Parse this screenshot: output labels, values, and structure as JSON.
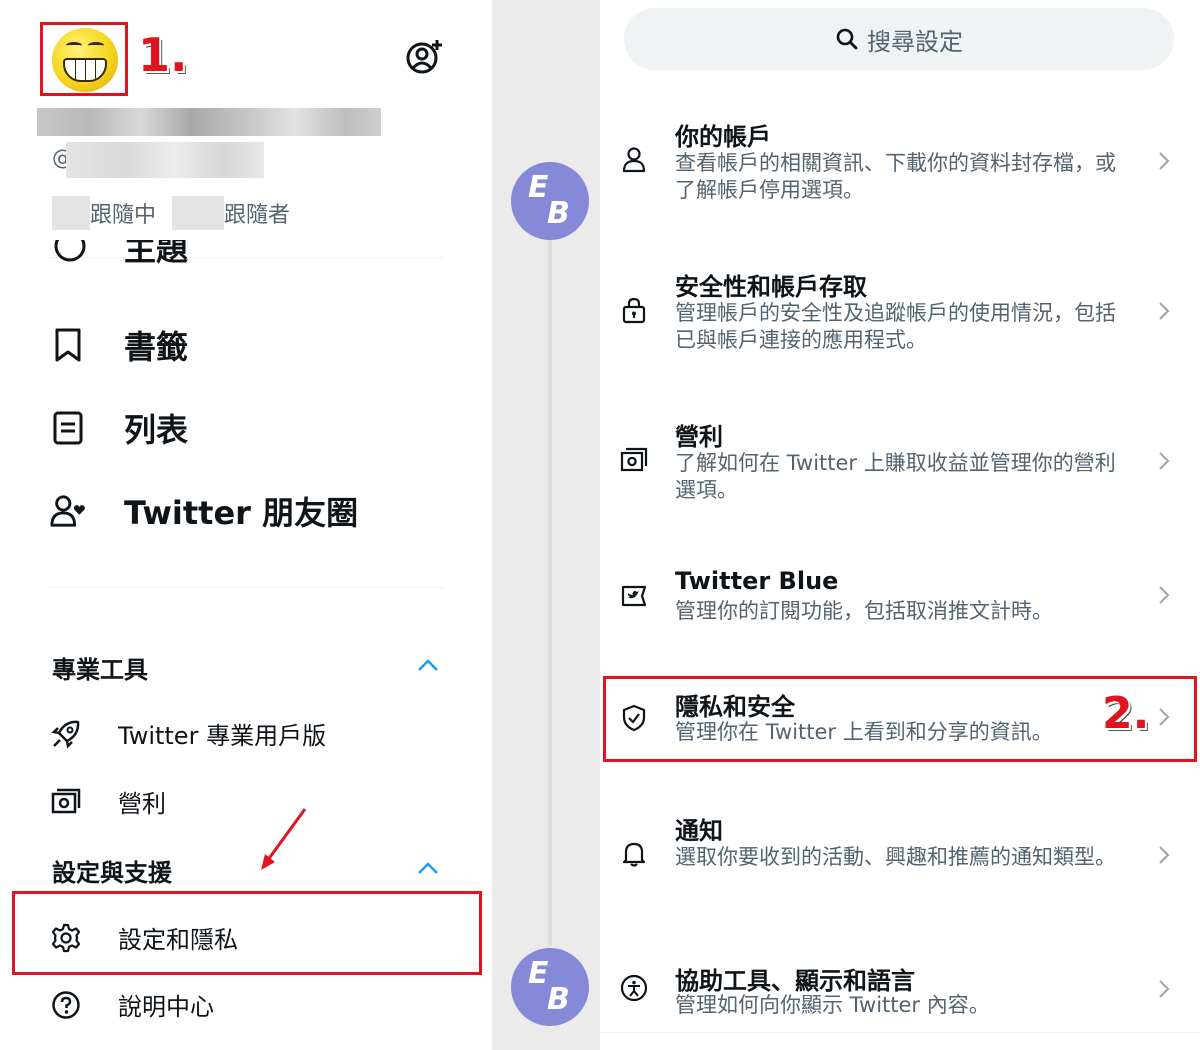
{
  "left_panel": {
    "step_one": "1.",
    "handle_prefix": "@",
    "following_label": "跟隨中",
    "followers_label": "跟隨者",
    "partial_item_label": "主題",
    "nav": [
      {
        "icon": "bookmark-icon",
        "label": "書籤"
      },
      {
        "icon": "list-icon",
        "label": "列表"
      },
      {
        "icon": "people-heart-icon",
        "label": "Twitter 朋友圈"
      }
    ],
    "section_pro": {
      "title": "專業工具",
      "items": [
        {
          "icon": "rocket-icon",
          "label": "Twitter 專業用戶版"
        },
        {
          "icon": "money-icon",
          "label": "營利"
        }
      ]
    },
    "section_settings": {
      "title": "設定與支援",
      "items": [
        {
          "icon": "gear-icon",
          "label": "設定和隱私"
        },
        {
          "icon": "help-icon",
          "label": "說明中心"
        }
      ]
    }
  },
  "middle": {
    "avatar_text_e": "E",
    "avatar_text_b": "B"
  },
  "right_panel": {
    "search_label": "搜尋設定",
    "step_two": "2.",
    "items": [
      {
        "icon": "person-icon",
        "title": "你的帳戶",
        "desc": "查看帳戶的相關資訊、下載你的資料封存檔，或了解帳戶停用選項。"
      },
      {
        "icon": "lock-icon",
        "title": "安全性和帳戶存取",
        "desc": "管理帳戶的安全性及追蹤帳戶的使用情況，包括已與帳戶連接的應用程式。"
      },
      {
        "icon": "money-icon",
        "title": "營利",
        "desc": "了解如何在 Twitter 上賺取收益並管理你的營利選項。"
      },
      {
        "icon": "twitter-blue-icon",
        "title": "Twitter Blue",
        "desc": "管理你的訂閱功能，包括取消推文計時。"
      },
      {
        "icon": "shield-check-icon",
        "title": "隱私和安全",
        "desc": "管理你在 Twitter 上看到和分享的資訊。"
      },
      {
        "icon": "bell-icon",
        "title": "通知",
        "desc": "選取你要收到的活動、興趣和推薦的通知類型。"
      },
      {
        "icon": "accessibility-icon",
        "title": "協助工具、顯示和語言",
        "desc": "管理如何向你顯示 Twitter 內容。"
      }
    ]
  },
  "colors": {
    "highlight": "#e0141e",
    "text": "#0f1419",
    "muted": "#536471",
    "accent": "#1d9bf0",
    "eb_avatar": "#8688d8"
  }
}
